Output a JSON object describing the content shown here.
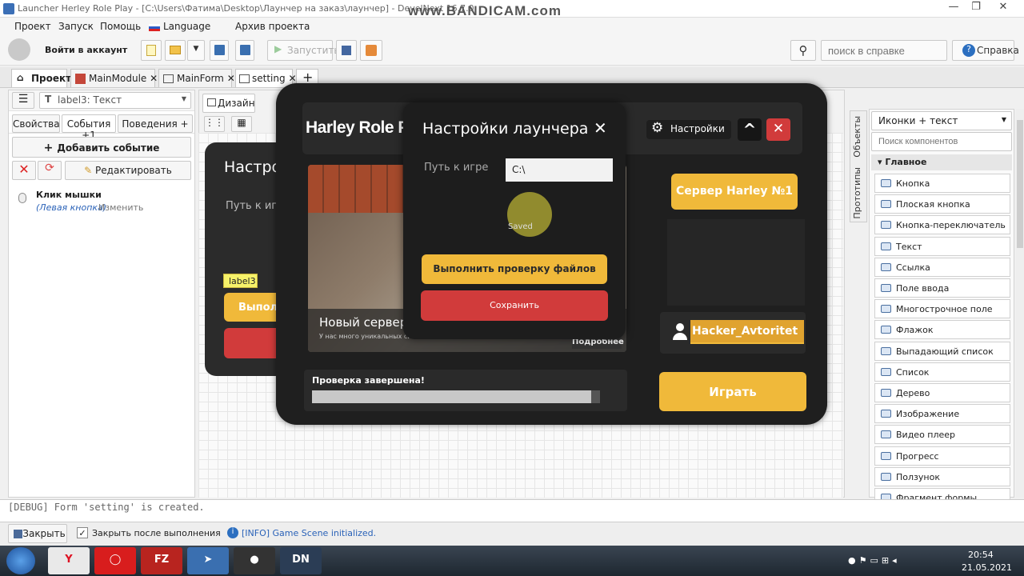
{
  "window": {
    "title": "Launcher Herley Role Play - [C:\\Users\\Фатима\\Desktop\\Лаунчер на заказ\\лаунчер] - DevelNext 16.7.0",
    "watermark": "www.BANDICAM.com",
    "buttons": [
      "—",
      "❐",
      "✕"
    ]
  },
  "menu": [
    "Проект",
    "Запуск",
    "Помощь",
    "Language",
    "Архив проекта"
  ],
  "toolbar": {
    "login": "Войти в аккаунт",
    "run": "Запустить",
    "search_placeholder": "поиск в справке",
    "help": "Справка"
  },
  "tabs": [
    {
      "label": "Проект"
    },
    {
      "label": "MainModule"
    },
    {
      "label": "MainForm"
    },
    {
      "label": "setting"
    }
  ],
  "left": {
    "selector": "label3: Текст",
    "subtabs": [
      "Свойства",
      "События +1",
      "Поведения +"
    ],
    "add_event": "Добавить событие",
    "edit": "Редактировать",
    "event_title": "Клик мышки",
    "event_desc": "(Левая кнопка)",
    "event_change": "Изменить"
  },
  "editor": {
    "design_tab": "Дизайн",
    "label_tag": "label3",
    "bg_title": "Настро",
    "bg_path": "Путь к иг",
    "bg_btn": "Выпол"
  },
  "launcher": {
    "title": "Harley Role Pl",
    "settings_btn": "Настройки",
    "server_btn": "Сервер Harley №1",
    "news_title": "Новый сервер!",
    "news_text": "У нас много уникальных систем и новых обновлений!",
    "news_more": "Подробнее",
    "status": "Проверка завершена!",
    "progress": 0.97,
    "username": "Hacker_Avtoritet",
    "play": "Играть"
  },
  "dialog": {
    "title": "Настройки лаунчера",
    "close": "✕",
    "path_label": "Путь к игре",
    "path_value": "C:\\",
    "saved": "Saved",
    "check_btn": "Выполнить проверку файлов",
    "save_btn": "Сохранить"
  },
  "right": {
    "dropdown": "Иконки + текст",
    "search_placeholder": "Поиск компонентов",
    "vtabs": [
      "Объекты",
      "Прототипы"
    ],
    "section": "Главное",
    "components": [
      "Кнопка",
      "Плоская кнопка",
      "Кнопка-переключатель",
      "Текст",
      "Ссылка",
      "Поле ввода",
      "Многострочное поле",
      "Флажок",
      "Выпадающий список",
      "Список",
      "Дерево",
      "Изображение",
      "Видео плеер",
      "Прогресс",
      "Ползунок",
      "Фрагмент формы"
    ]
  },
  "console": {
    "text": "[DEBUG] Form 'setting' is created."
  },
  "status": {
    "close": "Закрыть",
    "close_after": "Закрыть после выполнения",
    "info": "[INFO] Game Scene initialized."
  },
  "taskbar": {
    "time": "20:54",
    "date": "21.05.2021"
  },
  "colors": {
    "yellow": "#f0b93a",
    "red": "#d13b3b",
    "dark": "#1f1f1f"
  }
}
